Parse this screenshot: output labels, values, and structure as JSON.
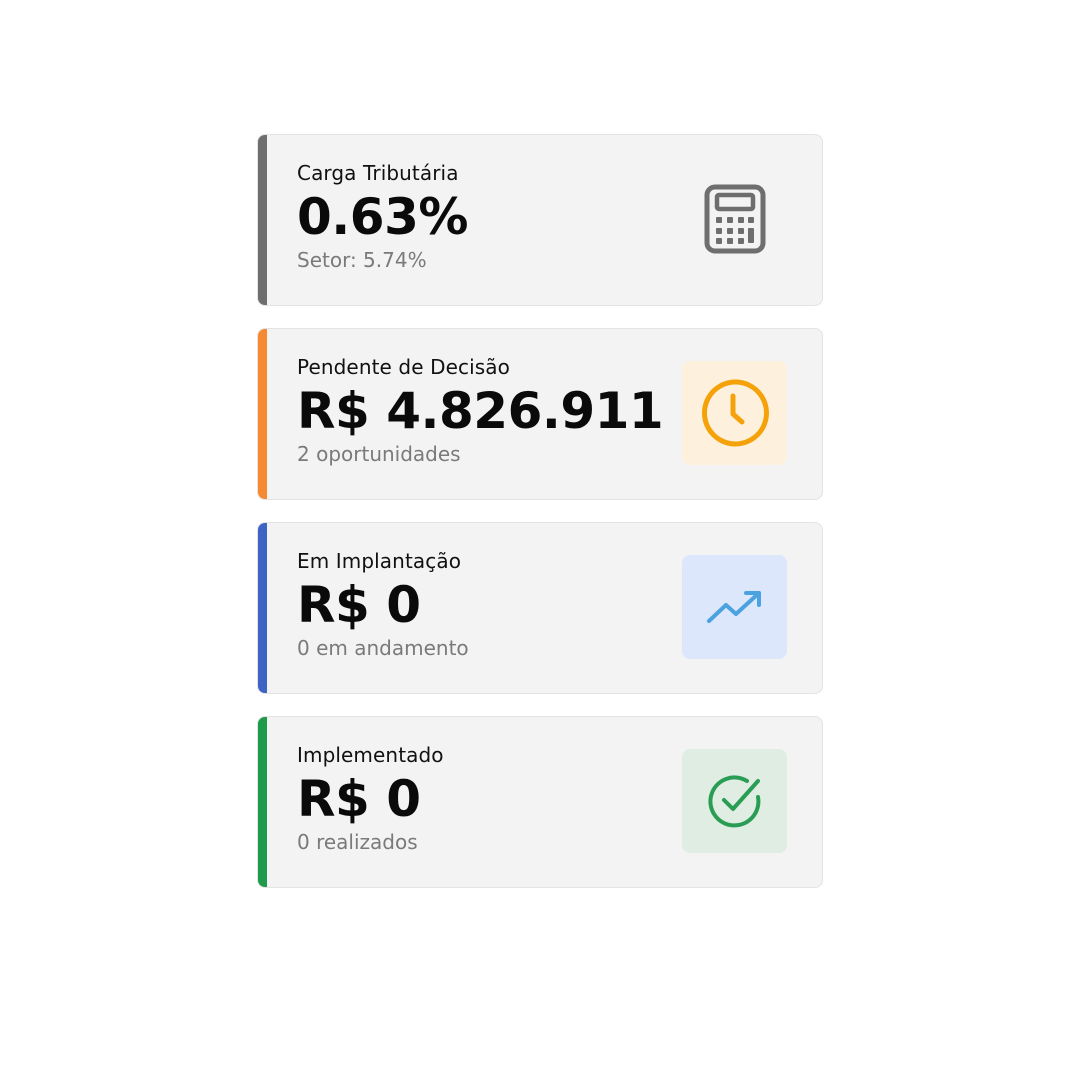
{
  "cards": [
    {
      "label": "Carga Tributária",
      "value": "0.63%",
      "sub": "Setor: 5.74%",
      "icon": "calculator-icon",
      "accent_color": "#6e6e6e",
      "icon_color": "#6e6e6e",
      "icon_bg": "transparent"
    },
    {
      "label": "Pendente de Decisão",
      "value": "R$ 4.826.911",
      "sub": "2 oportunidades",
      "icon": "clock-icon",
      "accent_color": "#f58a33",
      "icon_color": "#f5a20a",
      "icon_bg": "#fdf1de"
    },
    {
      "label": "Em Implantação",
      "value": "R$ 0",
      "sub": "0 em andamento",
      "icon": "trending-up-icon",
      "accent_color": "#3d63c4",
      "icon_color": "#4aa3e0",
      "icon_bg": "#dde7fb"
    },
    {
      "label": "Implementado",
      "value": "R$ 0",
      "sub": "0 realizados",
      "icon": "check-circle-icon",
      "accent_color": "#1f9a4b",
      "icon_color": "#2a9d55",
      "icon_bg": "#dfede3"
    }
  ]
}
